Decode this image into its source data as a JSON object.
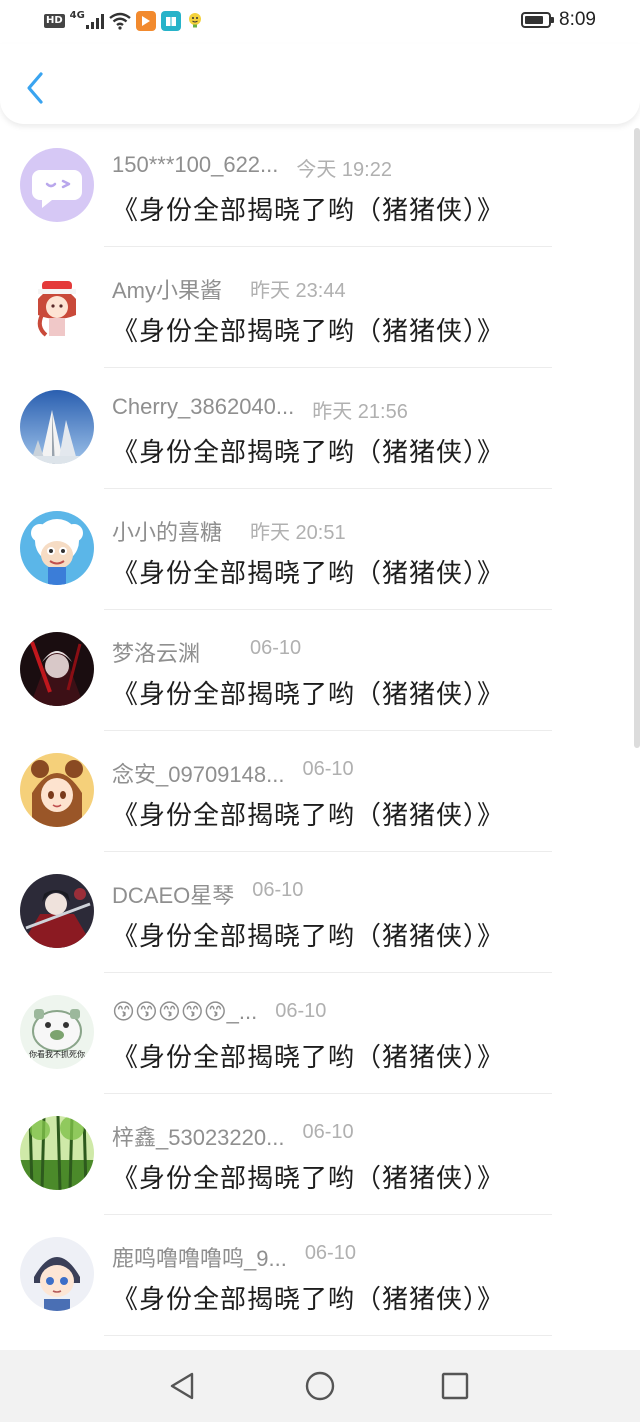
{
  "status_bar": {
    "hd": "HD",
    "network": "4G",
    "time": "8:09",
    "battery_level": 0.8
  },
  "header": {
    "back_icon": "chevron-left-icon",
    "accent": "#3aa4f0"
  },
  "list": [
    {
      "name": "150***100_622...",
      "time": "今天 19:22",
      "message": "《身份全部揭晓了哟（猪猪侠）》",
      "avatar": "chat-bubble-avatar"
    },
    {
      "name": "Amy小果酱",
      "time": "昨天 23:44",
      "message": "《身份全部揭晓了哟（猪猪侠）》",
      "avatar": "anime-girl-avatar"
    },
    {
      "name": "Cherry_3862040...",
      "time": "昨天 21:56",
      "message": "《身份全部揭晓了哟（猪猪侠）》",
      "avatar": "mountain-avatar"
    },
    {
      "name": "小小的喜糖",
      "time": "昨天 20:51",
      "message": "《身份全部揭晓了哟（猪猪侠）》",
      "avatar": "cartoon-sheep-avatar"
    },
    {
      "name": "梦洛云渊",
      "time": "06-10",
      "message": "《身份全部揭晓了哟（猪猪侠）》",
      "avatar": "dark-anime-avatar"
    },
    {
      "name": "念安_09709148...",
      "time": "06-10",
      "message": "《身份全部揭晓了哟（猪猪侠）》",
      "avatar": "anime-girl-brown-avatar"
    },
    {
      "name": "DCAEO星琴",
      "time": "06-10",
      "message": "《身份全部揭晓了哟（猪猪侠）》",
      "avatar": "anime-warrior-avatar"
    },
    {
      "name": "😙😙😙😙😙_...",
      "time": "06-10",
      "message": "《身份全部揭晓了哟（猪猪侠）》",
      "avatar": "cartoon-dog-avatar",
      "avatar_caption": "你看我不抓死你"
    },
    {
      "name": "梓鑫_53023220...",
      "time": "06-10",
      "message": "《身份全部揭晓了哟（猪猪侠）》",
      "avatar": "forest-avatar"
    },
    {
      "name": "鹿鸣噜噜噜鸣_9...",
      "time": "06-10",
      "message": "《身份全部揭晓了哟（猪猪侠）》",
      "avatar": "anime-boy-avatar"
    }
  ],
  "navbar": {
    "back": "triangle-back-icon",
    "home": "circle-home-icon",
    "recents": "square-recents-icon"
  }
}
